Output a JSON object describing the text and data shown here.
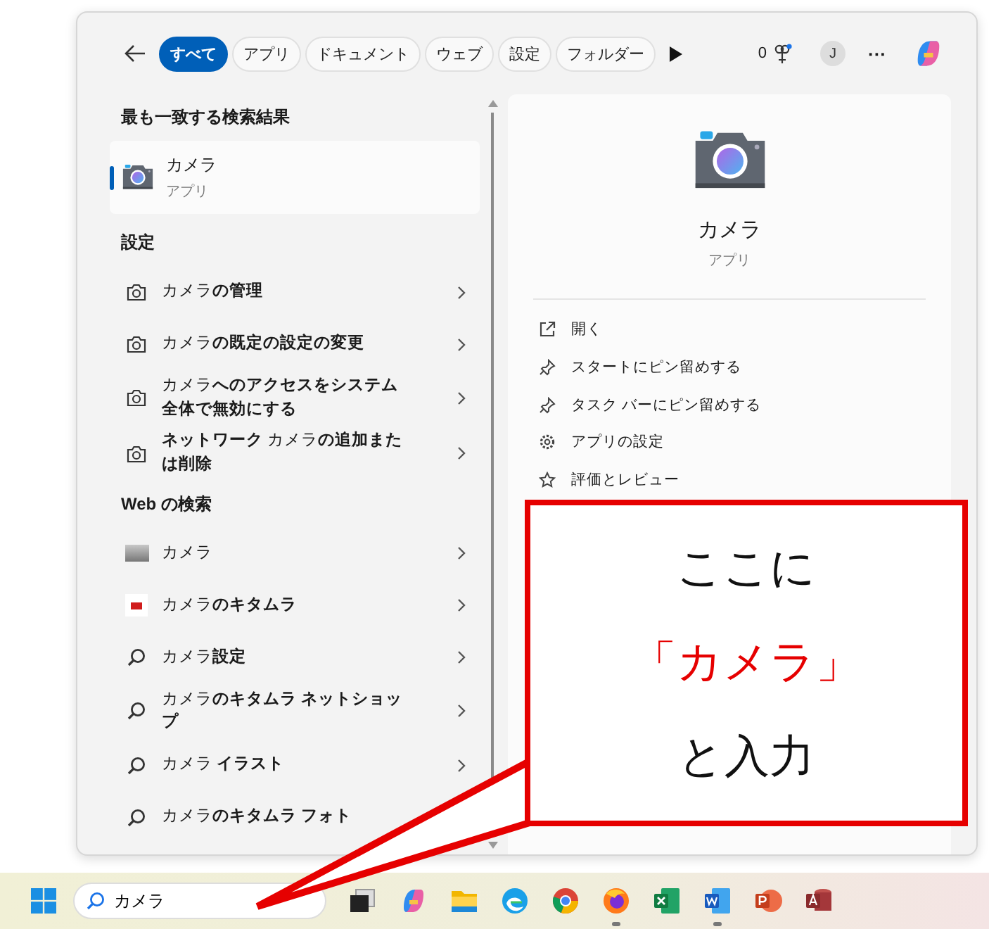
{
  "filter_bar": {
    "chips": [
      {
        "label": "すべて",
        "selected": true
      },
      {
        "label": "アプリ",
        "selected": false
      },
      {
        "label": "ドキュメント",
        "selected": false
      },
      {
        "label": "ウェブ",
        "selected": false
      },
      {
        "label": "設定",
        "selected": false
      },
      {
        "label": "フォルダー",
        "selected": false
      }
    ],
    "points": "0",
    "avatar": "J",
    "more": "···"
  },
  "best_match": {
    "heading": "最も一致する検索結果",
    "title": "カメラ",
    "subtitle": "アプリ",
    "selected": true
  },
  "settings": {
    "heading": "設定",
    "items": [
      {
        "kind": "setting",
        "text": "カメラ**の管理**"
      },
      {
        "kind": "setting",
        "text": "カメラ**の既定の設定の変更**"
      },
      {
        "kind": "setting",
        "text": "カメラ**へのアクセスをシステム全体で無効にする**"
      },
      {
        "kind": "setting",
        "text": "**ネットワーク** カメラ**の追加または削除**"
      }
    ]
  },
  "web": {
    "heading": "Web の検索",
    "items": [
      {
        "kind": "thumbnail",
        "text": "カメラ"
      },
      {
        "kind": "brand",
        "text": "カメラ**のキタムラ**"
      },
      {
        "kind": "search",
        "text": "カメラ**設定**"
      },
      {
        "kind": "search",
        "text": "カメラ**のキタムラ ネットショップ**"
      },
      {
        "kind": "search",
        "text": "カメラ **イラスト**"
      },
      {
        "kind": "search",
        "text": "カメラ**のキタムラ フォト**"
      }
    ]
  },
  "detail": {
    "title": "カメラ",
    "subtitle": "アプリ",
    "actions": [
      {
        "kind": "open",
        "label": "開く"
      },
      {
        "kind": "pin",
        "label": "スタートにピン留めする"
      },
      {
        "kind": "pin",
        "label": "タスク バーにピン留めする"
      },
      {
        "kind": "settings",
        "label": "アプリの設定"
      },
      {
        "kind": "star",
        "label": "評価とレビュー"
      }
    ]
  },
  "callout": {
    "lines": [
      {
        "kind": "plain",
        "text": "ここに"
      },
      {
        "kind": "highlight",
        "text": "「カメラ」"
      },
      {
        "kind": "plain",
        "text": "と入力"
      }
    ]
  },
  "taskbar": {
    "search_value": "カメラ",
    "apps": [
      {
        "kind": "taskview",
        "running": false
      },
      {
        "kind": "copilot",
        "running": false
      },
      {
        "kind": "explorer",
        "running": false
      },
      {
        "kind": "edge",
        "running": false
      },
      {
        "kind": "chrome",
        "running": false
      },
      {
        "kind": "firefox",
        "running": true
      },
      {
        "kind": "excel",
        "running": false
      },
      {
        "kind": "word",
        "running": true
      },
      {
        "kind": "powerpoint",
        "running": false
      },
      {
        "kind": "access",
        "running": false
      }
    ]
  }
}
